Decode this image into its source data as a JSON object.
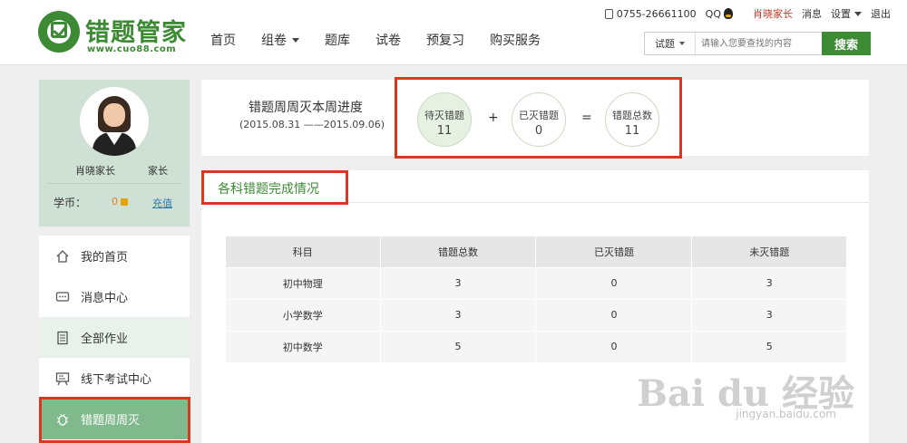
{
  "header": {
    "logo_text": "错题管家",
    "logo_url": "www.cuo88.com",
    "nav": [
      "首页",
      "组卷",
      "题库",
      "试卷",
      "预复习",
      "购买服务"
    ],
    "phone": "0755-26661100",
    "qq": "QQ",
    "user": "肖晓家长",
    "messages": "消息",
    "settings": "设置",
    "logout": "退出",
    "search_type": "试题",
    "search_placeholder": "请输入您要查找的内容",
    "search_button": "搜索"
  },
  "profile": {
    "name": "肖晓家长",
    "role": "家长",
    "coins_label": "学币：",
    "coins_value": "0",
    "recharge": "充值"
  },
  "menu": [
    "我的首页",
    "消息中心",
    "全部作业",
    "线下考试中心",
    "错题周周灭"
  ],
  "progress": {
    "title": "错题周周灭本周进度",
    "date_range": "(2015.08.31 ——2015.09.06)",
    "pending_label": "待灭错题",
    "pending_value": "11",
    "plus": "+",
    "done_label": "已灭错题",
    "done_value": "0",
    "equals": "=",
    "total_label": "错题总数",
    "total_value": "11"
  },
  "section": {
    "title": "各科错题完成情况",
    "columns": [
      "科目",
      "错题总数",
      "已灭错题",
      "未灭错题"
    ],
    "rows": [
      [
        "初中物理",
        "3",
        "0",
        "3"
      ],
      [
        "小学数学",
        "3",
        "0",
        "3"
      ],
      [
        "初中数学",
        "5",
        "0",
        "5"
      ]
    ]
  },
  "watermark": {
    "text": "Bai du 经验",
    "sub": "jingyan.baidu.com"
  }
}
